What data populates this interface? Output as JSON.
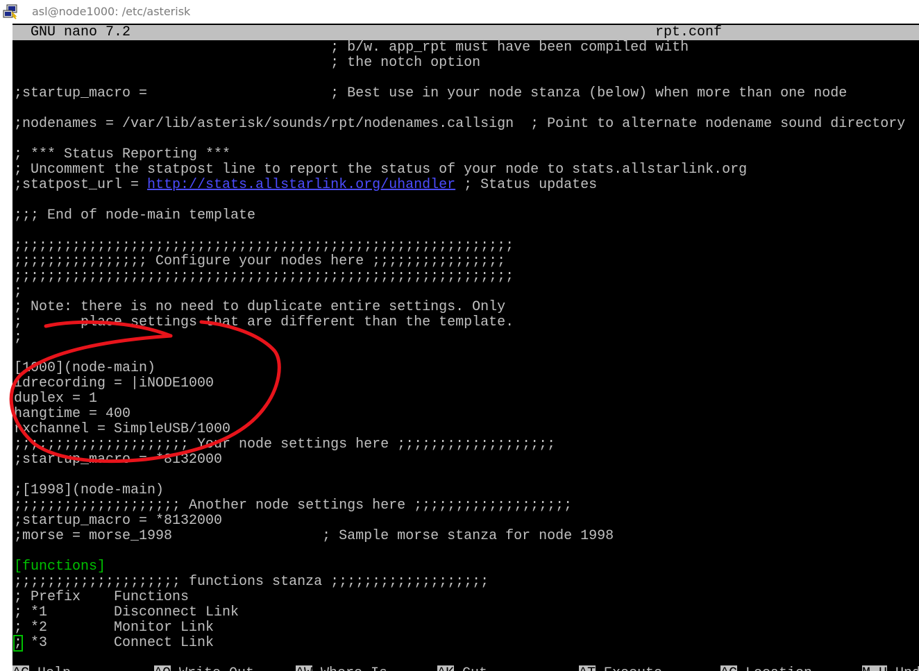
{
  "window": {
    "title": "asl@node1000: /etc/asterisk",
    "icon": "putty-icon"
  },
  "nano": {
    "version": "GNU nano 7.2",
    "filename": "rpt.conf"
  },
  "lines": [
    [
      {
        "t": "                                      ; b/w. app_rpt must have been compiled with"
      }
    ],
    [
      {
        "t": "                                      ; the notch option"
      }
    ],
    [
      {
        "t": ""
      }
    ],
    [
      {
        "t": ";startup_macro =                      ; Best use in your node stanza (below) when more than one node"
      }
    ],
    [
      {
        "t": ""
      }
    ],
    [
      {
        "t": ";nodenames = /var/lib/asterisk/sounds/rpt/nodenames.callsign  ; Point to alternate nodename sound directory"
      }
    ],
    [
      {
        "t": ""
      }
    ],
    [
      {
        "t": "; *** Status Reporting ***"
      }
    ],
    [
      {
        "t": "; Uncomment the statpost line to report the status of your node to stats.allstarlink.org"
      }
    ],
    [
      {
        "t": ";statpost_url = "
      },
      {
        "t": "http://stats.allstarlink.org/uhandler",
        "c": "url"
      },
      {
        "t": " ; Status updates"
      }
    ],
    [
      {
        "t": ""
      }
    ],
    [
      {
        "t": ";;; End of node-main template"
      }
    ],
    [
      {
        "t": ""
      }
    ],
    [
      {
        "t": ";;;;;;;;;;;;;;;;;;;;;;;;;;;;;;;;;;;;;;;;;;;;;;;;;;;;;;;;;;;;"
      }
    ],
    [
      {
        "t": ";;;;;;;;;;;;;;;; Configure your nodes here ;;;;;;;;;;;;;;;;"
      }
    ],
    [
      {
        "t": ";;;;;;;;;;;;;;;;;;;;;;;;;;;;;;;;;;;;;;;;;;;;;;;;;;;;;;;;;;;;"
      }
    ],
    [
      {
        "t": ";"
      }
    ],
    [
      {
        "t": "; Note: there is no need to duplicate entire settings. Only"
      }
    ],
    [
      {
        "t": ";       place settings that are different than the template."
      }
    ],
    [
      {
        "t": ";"
      }
    ],
    [
      {
        "t": ""
      }
    ],
    [
      {
        "t": "[1000](node-main)"
      }
    ],
    [
      {
        "t": "idrecording = |iNODE1000"
      }
    ],
    [
      {
        "t": "duplex = 1"
      }
    ],
    [
      {
        "t": "hangtime = 400"
      }
    ],
    [
      {
        "t": "rxchannel = SimpleUSB/1000"
      }
    ],
    [
      {
        "t": ";;;;;;;;;;;;;;;;;;;;; Your node settings here ;;;;;;;;;;;;;;;;;;;"
      }
    ],
    [
      {
        "t": ";startup_macro = *8132000"
      }
    ],
    [
      {
        "t": ""
      }
    ],
    [
      {
        "t": ";[1998](node-main)"
      }
    ],
    [
      {
        "t": ";;;;;;;;;;;;;;;;;;;; Another node settings here ;;;;;;;;;;;;;;;;;;;"
      }
    ],
    [
      {
        "t": ";startup_macro = *8132000"
      }
    ],
    [
      {
        "t": ";morse = morse_1998                  ; Sample morse stanza for node 1998"
      }
    ],
    [
      {
        "t": ""
      }
    ],
    [
      {
        "t": "[functions]",
        "c": "green"
      }
    ],
    [
      {
        "t": ";;;;;;;;;;;;;;;;;;;; functions stanza ;;;;;;;;;;;;;;;;;;;"
      }
    ],
    [
      {
        "t": "; Prefix    Functions"
      }
    ],
    [
      {
        "t": "; *1        Disconnect Link"
      }
    ],
    [
      {
        "t": "; *2        Monitor Link"
      }
    ],
    [
      {
        "t": ";",
        "c": "cursor"
      },
      {
        "t": " *3        Connect Link"
      }
    ]
  ],
  "shortcuts": [
    {
      "key": "^G",
      "label": " Help"
    },
    {
      "key": "^O",
      "label": " Write Out"
    },
    {
      "key": "^W",
      "label": " Where Is"
    },
    {
      "key": "^K",
      "label": " Cut"
    },
    {
      "key": "^T",
      "label": " Execute"
    },
    {
      "key": "^C",
      "label": " Location"
    },
    {
      "key": "M-U",
      "label": " Undo"
    }
  ],
  "colors": {
    "terminal_bg": "#000000",
    "terminal_fg": "#c0c0c0",
    "header_bg": "#c0c0c0",
    "url": "#4c4cff",
    "section": "#00c000",
    "annotation": "#e8141b"
  }
}
